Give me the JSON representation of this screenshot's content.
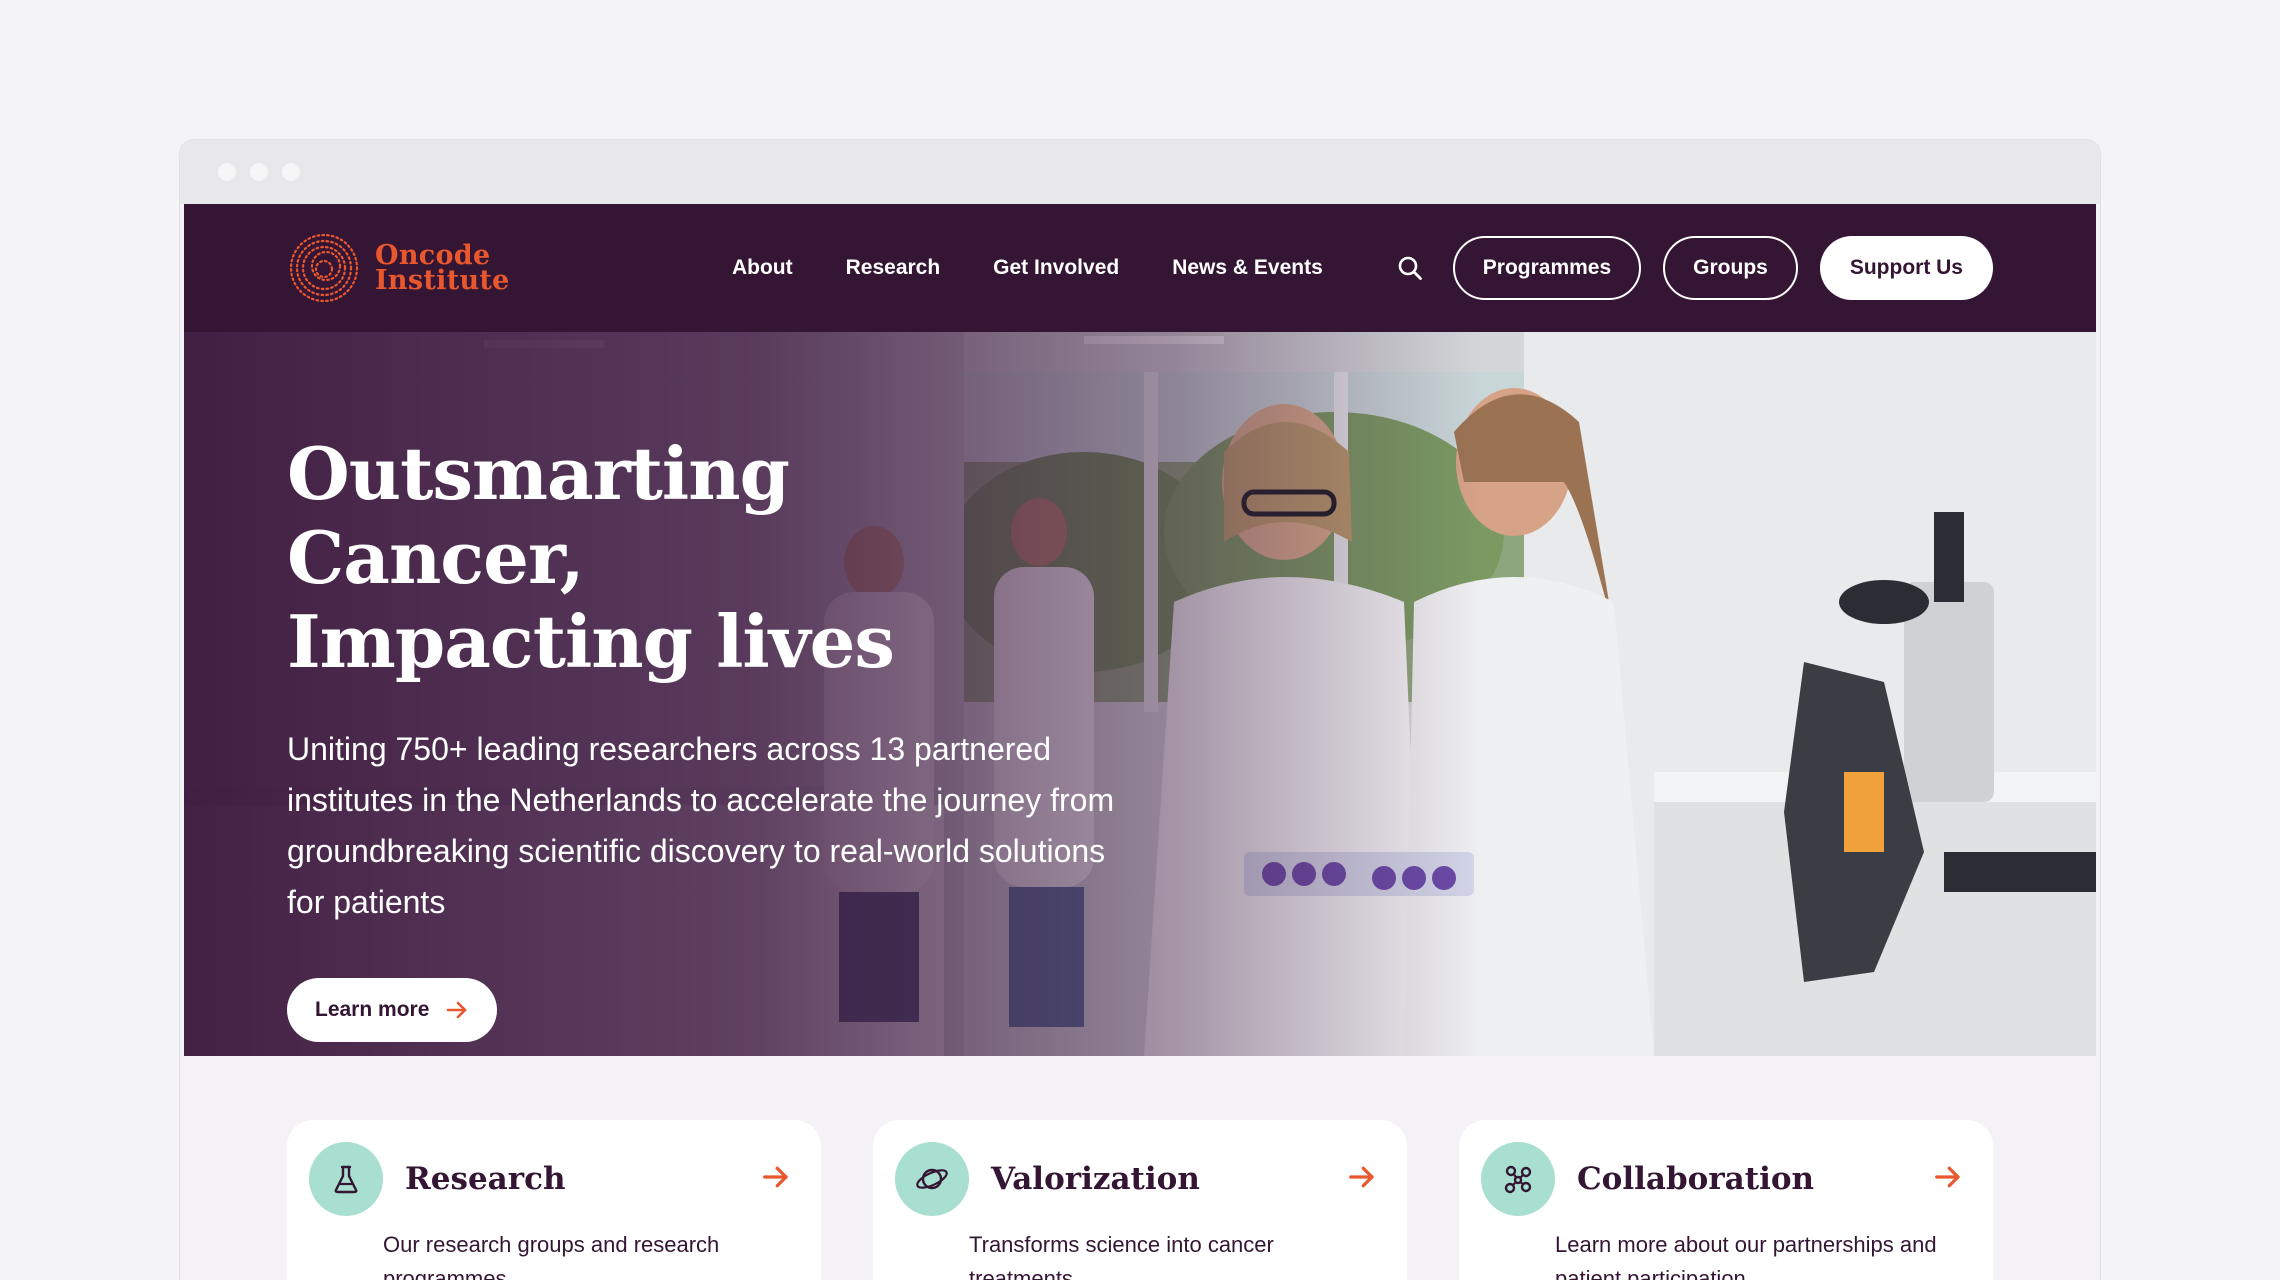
{
  "brand": {
    "line1": "Oncode",
    "line2": "Institute"
  },
  "nav": {
    "items": [
      {
        "label": "About"
      },
      {
        "label": "Research"
      },
      {
        "label": "Get Involved"
      },
      {
        "label": "News & Events"
      }
    ],
    "search_icon": "search-icon",
    "programmes_label": "Programmes",
    "groups_label": "Groups",
    "support_label": "Support Us"
  },
  "hero": {
    "title_line1": "Outsmarting Cancer,",
    "title_line2": "Impacting lives",
    "subtitle": "Uniting 750+ leading researchers across 13 partnered institutes in the Netherlands to accelerate the journey from groundbreaking scientific discovery to real-world solutions for patients",
    "cta_label": "Learn more"
  },
  "cards": [
    {
      "title": "Research",
      "description": "Our research groups and research programmes",
      "icon": "flask-icon"
    },
    {
      "title": "Valorization",
      "description": "Transforms science into cancer treatments",
      "icon": "planet-icon"
    },
    {
      "title": "Collaboration",
      "description": "Learn more about our partnerships and patient participation",
      "icon": "network-icon"
    }
  ],
  "colors": {
    "nav_bg": "#341634",
    "brand_orange": "#e8572d",
    "icon_bg": "#a9dfd0",
    "page_bg": "#f4f2f6"
  }
}
